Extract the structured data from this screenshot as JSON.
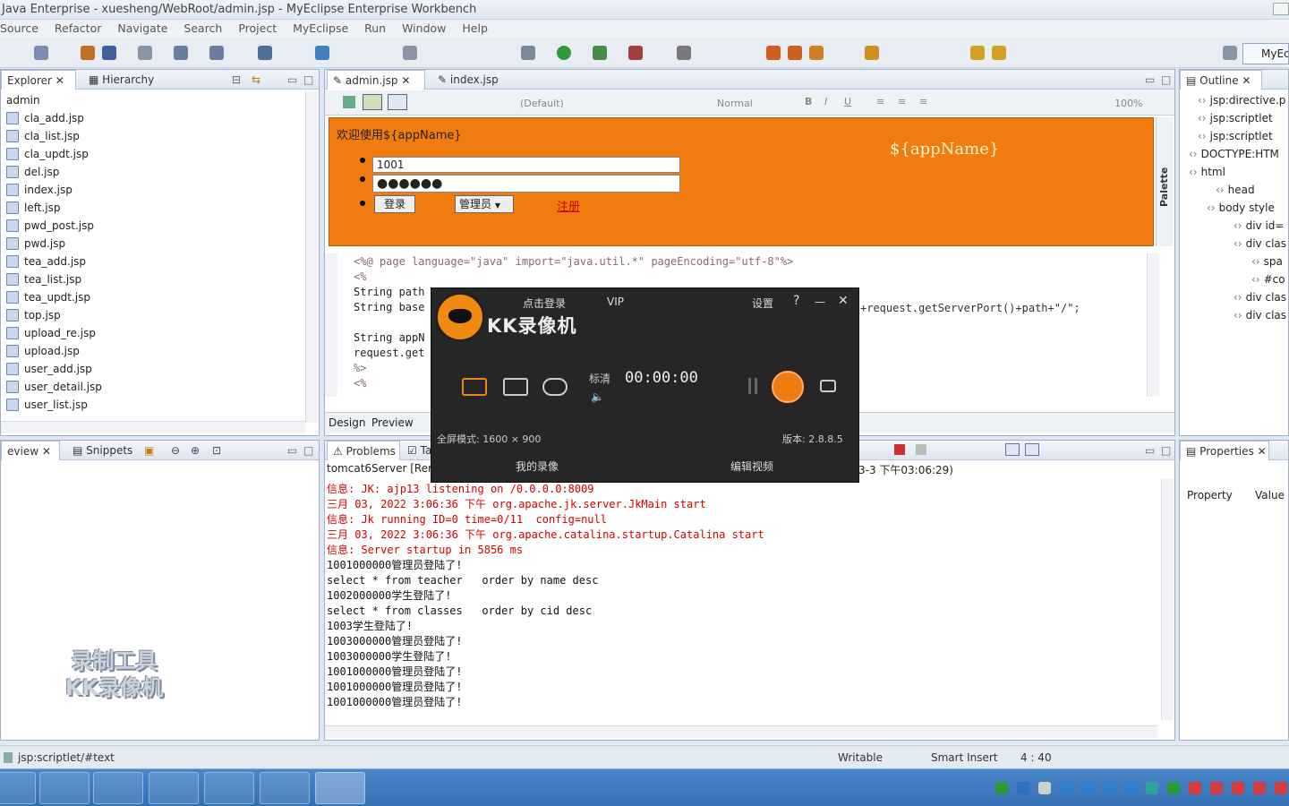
{
  "window": {
    "title": "Java Enterprise - xuesheng/WebRoot/admin.jsp - MyEclipse Enterprise Workbench"
  },
  "menu": [
    "Source",
    "Refactor",
    "Navigate",
    "Search",
    "Project",
    "MyEclipse",
    "Run",
    "Window",
    "Help"
  ],
  "perspective": "MyEc",
  "explorer": {
    "tabs": [
      "Explorer",
      "Hierarchy"
    ],
    "root": "admin",
    "files": [
      "cla_add.jsp",
      "cla_list.jsp",
      "cla_updt.jsp",
      "del.jsp",
      "index.jsp",
      "left.jsp",
      "pwd_post.jsp",
      "pwd.jsp",
      "tea_add.jsp",
      "tea_list.jsp",
      "tea_updt.jsp",
      "top.jsp",
      "upload_re.jsp",
      "upload.jsp",
      "user_add.jsp",
      "user_detail.jsp",
      "user_list.jsp"
    ]
  },
  "editor": {
    "tabs": [
      "admin.jsp",
      "index.jsp"
    ],
    "design_toolbar": {
      "font": "(Default)",
      "style": "Normal",
      "zoom": "100%"
    },
    "preview": {
      "welcome": "欢迎使用${appName}",
      "appname_right": "${appName}",
      "username_value": "1001",
      "password_value": "●●●●●●",
      "login_button": "登录",
      "role_select": "管理员",
      "register_link": "注册"
    },
    "palette": "Palette",
    "code_lines": [
      "<%@ page language=\"java\" import=\"java.util.*\" pageEncoding=\"utf-8\"%>",
      "<%",
      "String path",
      "String base",
      "",
      "String appN",
      "request.get",
      "%>",
      "<%"
    ],
    "code_right": "+request.getServerPort()+path+\"/\";",
    "bottom_tabs": [
      "Design",
      "Preview"
    ]
  },
  "outline": {
    "title": "Outline",
    "items": [
      "jsp:directive.p",
      "jsp:scriptlet",
      "jsp:scriptlet",
      "DOCTYPE:HTM",
      "html",
      "head",
      "body style",
      "div id=",
      "div clas",
      "spa",
      "#co",
      "div clas",
      "div clas"
    ]
  },
  "left_bottom": {
    "tabs": [
      "eview",
      "Snippets"
    ]
  },
  "console": {
    "tabs": [
      "Problems",
      "Ta"
    ],
    "server": "tomcat6Server [Rem",
    "time_right": "3-3 下午03:06:29)",
    "lines": [
      {
        "text": "信息: JK: ajp13 listening on /0.0.0.0:8009",
        "color": "red"
      },
      {
        "text": "三月 03, 2022 3:06:36 下午 org.apache.jk.server.JkMain start",
        "color": "red"
      },
      {
        "text": "信息: Jk running ID=0 time=0/11  config=null",
        "color": "red"
      },
      {
        "text": "三月 03, 2022 3:06:36 下午 org.apache.catalina.startup.Catalina start",
        "color": "red"
      },
      {
        "text": "信息: Server startup in 5856 ms",
        "color": "red"
      },
      {
        "text": "1001000000管理员登陆了!",
        "color": "blk"
      },
      {
        "text": "select * from teacher   order by name desc",
        "color": "blk"
      },
      {
        "text": "1002000000学生登陆了!",
        "color": "blk"
      },
      {
        "text": "select * from classes   order by cid desc",
        "color": "blk"
      },
      {
        "text": "1003学生登陆了!",
        "color": "blk"
      },
      {
        "text": "1003000000管理员登陆了!",
        "color": "blk"
      },
      {
        "text": "1003000000学生登陆了!",
        "color": "blk"
      },
      {
        "text": "1001000000管理员登陆了!",
        "color": "blk"
      },
      {
        "text": "1001000000管理员登陆了!",
        "color": "blk"
      },
      {
        "text": "1001000000管理员登陆了!",
        "color": "blk"
      }
    ]
  },
  "properties": {
    "title": "Properties",
    "col_property": "Property",
    "col_value": "Value"
  },
  "status": {
    "path": "jsp:scriptlet/#text",
    "mode": "Writable",
    "insert": "Smart Insert",
    "position": "4 : 40"
  },
  "recorder": {
    "login": "点击登录",
    "vip": "VIP",
    "settings": "设置",
    "help": "?",
    "minimize": "—",
    "close": "✕",
    "brand": "KK录像机",
    "quality": "标清",
    "timer": "00:00:00",
    "mode_text": "全屏模式: 1600 × 900",
    "version": "版本: 2.8.8.5",
    "my_recordings": "我的录像",
    "edit_video": "编辑视频"
  },
  "watermark": {
    "line1": "录制工具",
    "line2": "KK录像机"
  },
  "colors": {
    "orange": "#f08a10",
    "console_red": "#d40000",
    "taskbar": "#3d78bd"
  }
}
